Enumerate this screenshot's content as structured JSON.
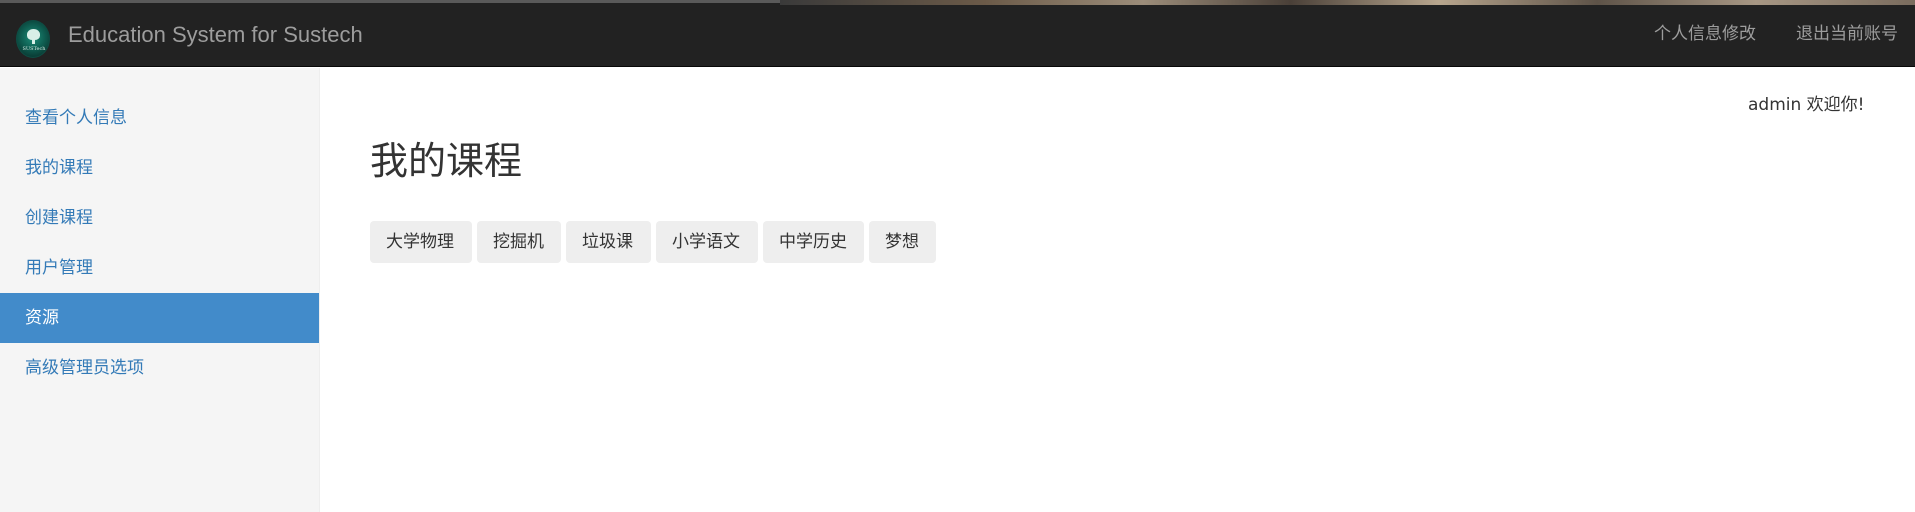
{
  "navbar": {
    "brand_title": "Education System for Sustech",
    "logo_text": "SUSTech",
    "profile_link": "个人信息修改",
    "logout_link": "退出当前账号"
  },
  "sidebar": {
    "items": [
      {
        "label": "查看个人信息",
        "active": false
      },
      {
        "label": "我的课程",
        "active": false
      },
      {
        "label": "创建课程",
        "active": false
      },
      {
        "label": "用户管理",
        "active": false
      },
      {
        "label": "资源",
        "active": true
      },
      {
        "label": "高级管理员选项",
        "active": false
      }
    ]
  },
  "main": {
    "welcome": "admin 欢迎你!",
    "title": "我的课程",
    "courses": [
      "大学物理",
      "挖掘机",
      "垃圾课",
      "小学语文",
      "中学历史",
      "梦想"
    ]
  },
  "colors": {
    "navbar_bg": "#222222",
    "sidebar_bg": "#f5f5f5",
    "active_item": "#428bca",
    "link": "#337ab7",
    "button_bg": "#eeeeee"
  },
  "icons": {
    "logo": "sustech-logo-icon"
  }
}
